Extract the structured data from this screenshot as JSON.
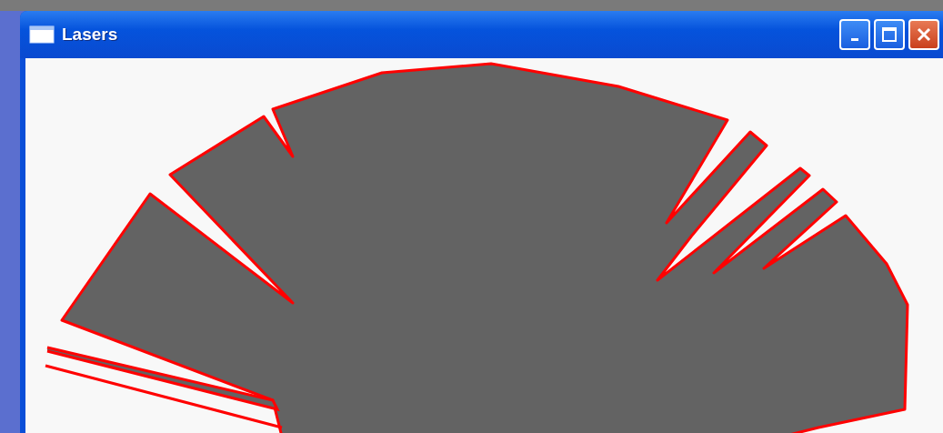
{
  "window": {
    "title": "Lasers"
  }
}
